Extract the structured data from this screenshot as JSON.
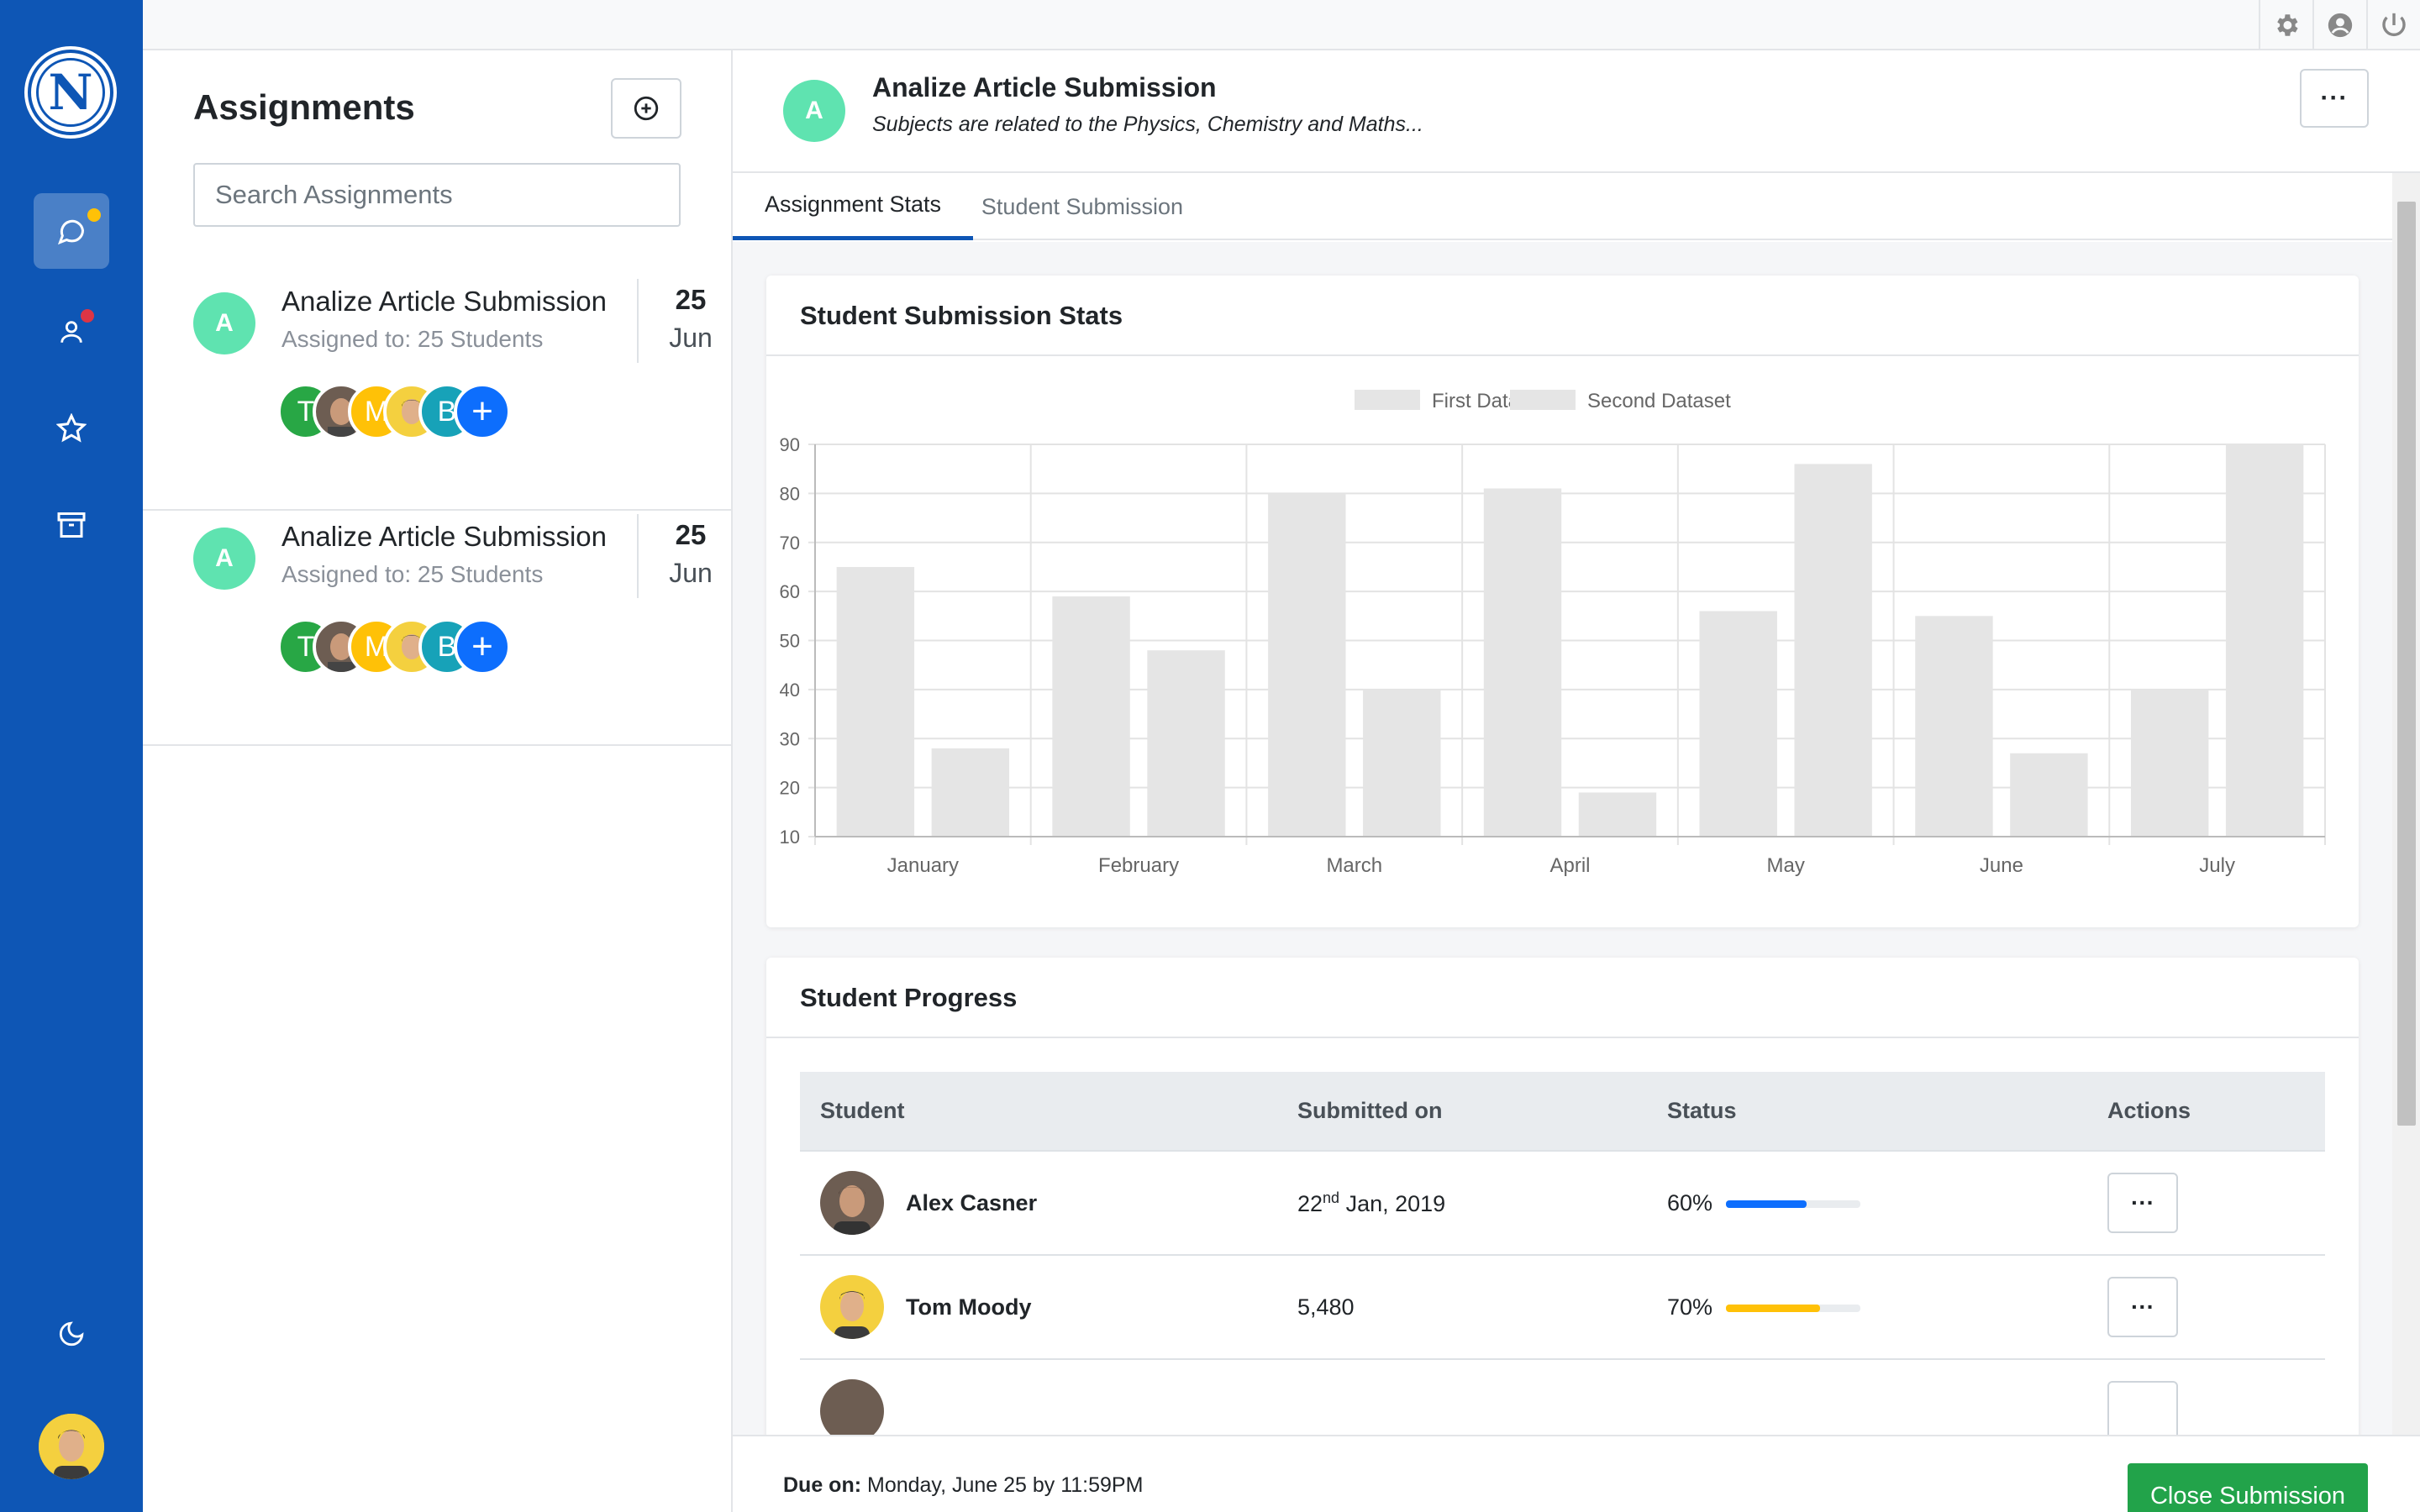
{
  "app": {
    "logo_letter": "N"
  },
  "nav": {
    "items": [
      {
        "name": "messages",
        "icon": "chat-icon",
        "active": true,
        "badge": "#ffc107"
      },
      {
        "name": "users",
        "icon": "user-icon",
        "active": false,
        "badge": "#dc3545"
      },
      {
        "name": "favorites",
        "icon": "star-icon",
        "active": false
      },
      {
        "name": "archive",
        "icon": "archive-icon",
        "active": false
      }
    ],
    "bottom": [
      {
        "name": "dark-mode",
        "icon": "moon-icon"
      }
    ]
  },
  "topbar": {
    "icons": [
      "gear-icon",
      "account-icon",
      "power-icon"
    ]
  },
  "assignments": {
    "title": "Assignments",
    "search_placeholder": "Search Assignments",
    "items": [
      {
        "avatar": "A",
        "title": "Analize Article Submission",
        "assigned": "Assigned to: 25 Students",
        "day": "25",
        "month": "Jun",
        "members": [
          "T",
          "",
          "M",
          "",
          "B"
        ]
      },
      {
        "avatar": "A",
        "title": "Analize Article Submission",
        "assigned": "Assigned to: 25 Students",
        "day": "25",
        "month": "Jun",
        "members": [
          "T",
          "",
          "M",
          "",
          "B"
        ]
      }
    ]
  },
  "detail": {
    "avatar": "A",
    "title": "Analize Article Submission",
    "subtitle": "Subjects are related to the Physics, Chemistry and Maths...",
    "more_label": "···",
    "tabs": [
      {
        "label": "Assignment Stats",
        "active": true
      },
      {
        "label": "Student Submission",
        "active": false
      }
    ],
    "stats_title": "Student Submission Stats",
    "progress_title": "Student Progress",
    "table_headers": {
      "student": "Student",
      "submitted": "Submitted on",
      "status": "Status",
      "actions": "Actions"
    },
    "students": [
      {
        "name": "Alex Casner",
        "submitted_day": "22",
        "submitted_sup": "nd",
        "submitted_rest": " Jan, 2019",
        "progress_label": "60%",
        "progress": 0.6,
        "color": "#0d6efd"
      },
      {
        "name": "Tom Moody",
        "submitted_day": "5,480",
        "submitted_sup": "",
        "submitted_rest": "",
        "progress_label": "70%",
        "progress": 0.7,
        "color": "#ffc107"
      }
    ],
    "due_label": "Due on:",
    "due_value": " Monday, June 25 by 11:59PM",
    "close_label": "Close Submission"
  },
  "chart_data": {
    "type": "bar",
    "categories": [
      "January",
      "February",
      "March",
      "April",
      "May",
      "June",
      "July"
    ],
    "series": [
      {
        "name": "First Dataset",
        "values": [
          65,
          59,
          80,
          81,
          56,
          55,
          40
        ]
      },
      {
        "name": "Second Dataset",
        "values": [
          28,
          48,
          40,
          19,
          86,
          27,
          90
        ]
      }
    ],
    "ylim": [
      10,
      90
    ],
    "yticks": [
      10,
      20,
      30,
      40,
      50,
      60,
      70,
      80,
      90
    ],
    "grid": true,
    "legend": "top-center",
    "bar_color": "#e5e5e5"
  }
}
